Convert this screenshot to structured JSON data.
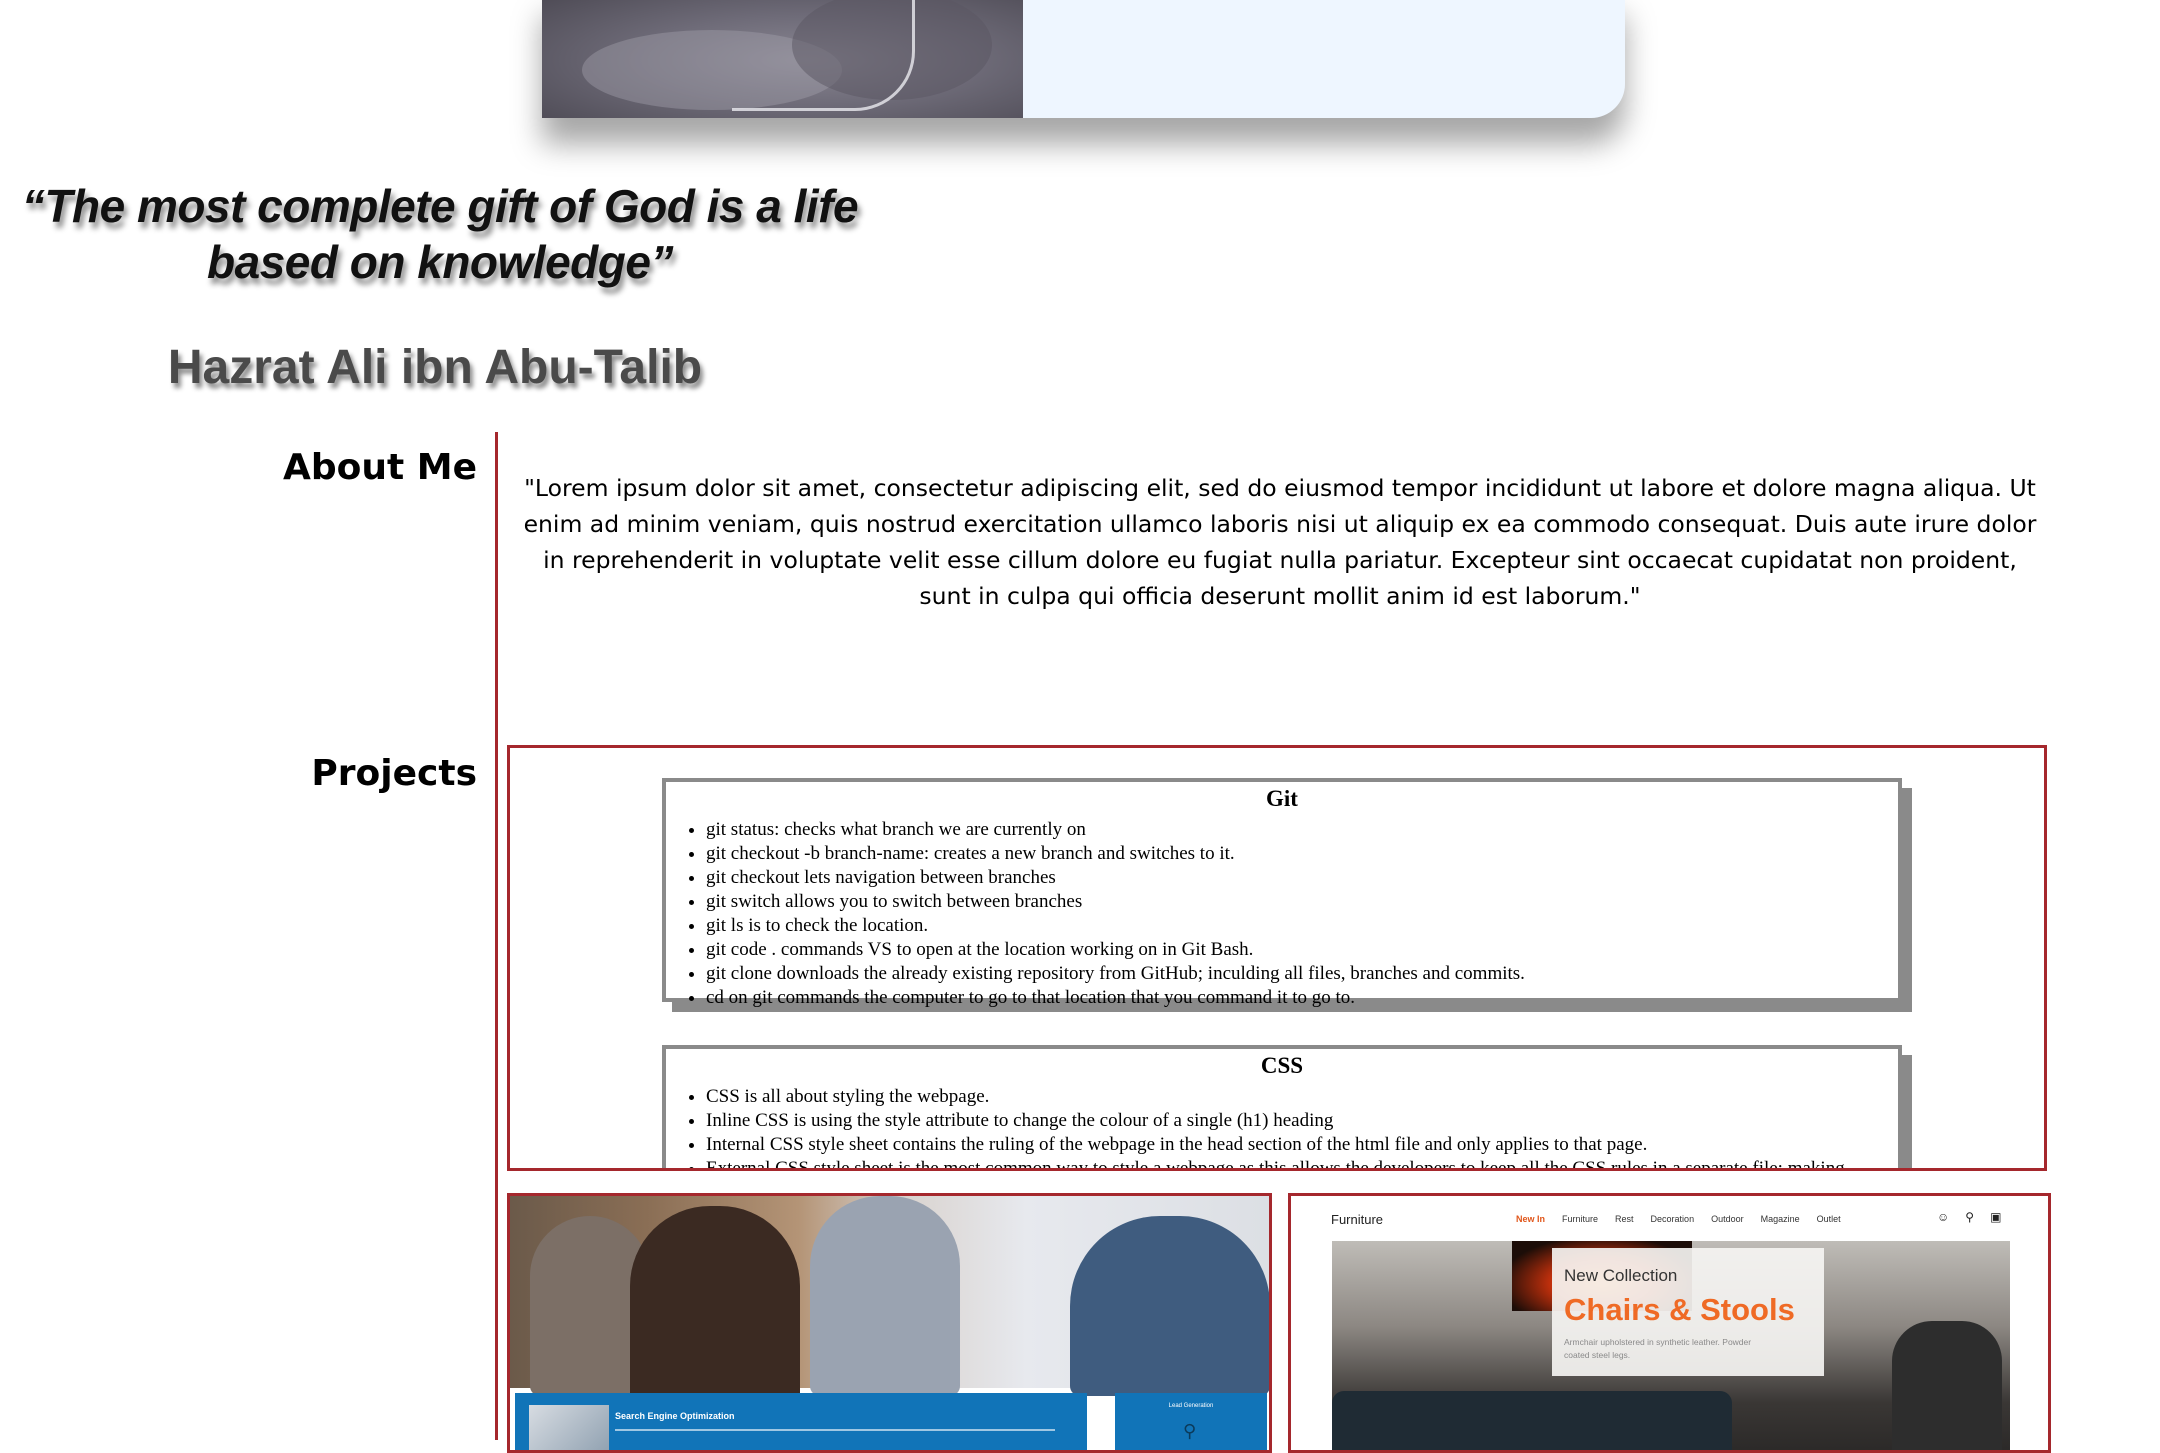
{
  "quote": {
    "text": "“The most complete gift of God is a life based on knowledge”",
    "author": "Hazrat Ali ibn Abu-Talib"
  },
  "about": {
    "heading": "About Me",
    "body": "\"Lorem ipsum dolor sit amet, consectetur adipiscing elit, sed do eiusmod tempor incididunt ut labore et dolore magna aliqua. Ut enim ad minim veniam, quis nostrud exercitation ullamco laboris nisi ut aliquip ex ea commodo consequat. Duis aute irure dolor in reprehenderit in voluptate velit esse cillum dolore eu fugiat nulla pariatur. Excepteur sint occaecat cupidatat non proident, sunt in culpa qui officia deserunt mollit anim id est laborum.\""
  },
  "projects": {
    "heading": "Projects",
    "git": {
      "title": "Git",
      "items": [
        "git status: checks what branch we are currently on",
        "git checkout -b branch-name: creates a new branch and switches to it.",
        "git checkout lets navigation between branches",
        "git switch allows you to switch between branches",
        "git ls is to check the location.",
        "git code . commands VS to open at the location working on in Git Bash.",
        "git clone downloads the already existing repository from GitHub; inculding all files, branches and commits.",
        "cd on git commands the computer to go to that location that you command it to go to."
      ]
    },
    "css": {
      "title": "CSS",
      "items": [
        "CSS is all about styling the webpage.",
        "Inline CSS is using the style attribute to change the colour of a single (h1) heading",
        "Internal CSS style sheet contains the ruling of the webpage in the head section of the html file and only applies to that page.",
        "External CSS style sheet is the most common way to style a webpage as this allows the developers to keep all the CSS rules in a separate file; making"
      ]
    }
  },
  "thumbnails": {
    "seo": {
      "title": "Search Engine Optimization",
      "side_label": "Lead Generation",
      "bulb_icon": "lightbulb-icon"
    },
    "furniture": {
      "brand": "Furniture",
      "menu": [
        "New In",
        "Furniture",
        "Rest",
        "Decoration",
        "Outdoor",
        "Magazine",
        "Outlet"
      ],
      "icons": [
        "user-icon",
        "search-icon",
        "bag-icon"
      ],
      "kicker": "New Collection",
      "headline": "Chairs & Stools",
      "description": "Armchair upholstered in synthetic leather. Powder coated steel legs.",
      "accent_color": "#ef6a25"
    }
  },
  "colors": {
    "border_accent": "#a5282d",
    "card_shadow": "#8a8a8a",
    "seo_blue": "#1174b8"
  }
}
